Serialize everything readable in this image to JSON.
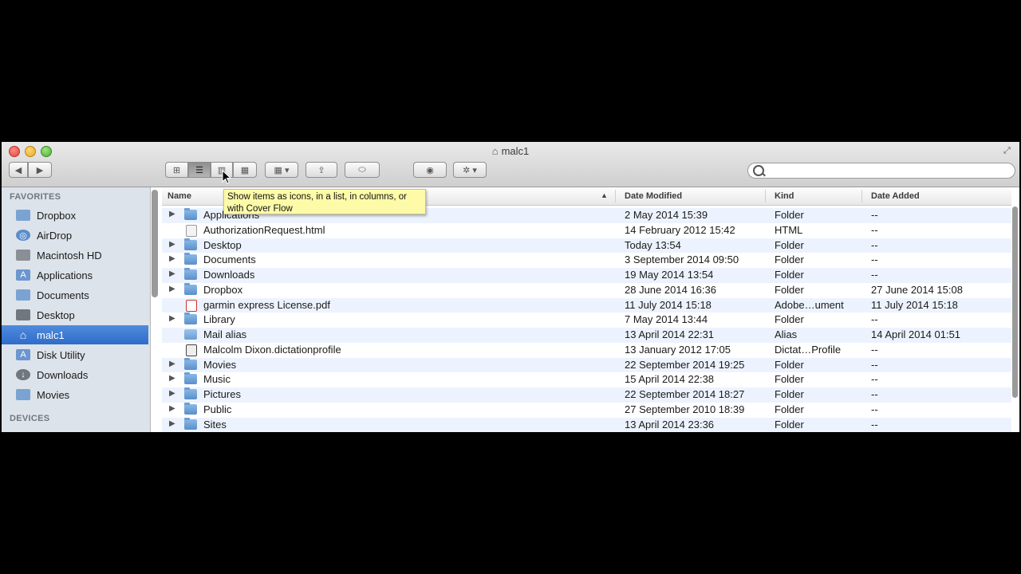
{
  "window": {
    "title": "malc1"
  },
  "search": {
    "placeholder": ""
  },
  "sidebar": {
    "favorites_header": "FAVORITES",
    "devices_header": "DEVICES",
    "items": [
      {
        "label": "Dropbox",
        "icon": "folder-icon"
      },
      {
        "label": "AirDrop",
        "icon": "airdrop-icon"
      },
      {
        "label": "Macintosh HD",
        "icon": "hard-drive-icon"
      },
      {
        "label": "Applications",
        "icon": "applications-icon"
      },
      {
        "label": "Documents",
        "icon": "documents-icon"
      },
      {
        "label": "Desktop",
        "icon": "desktop-icon"
      },
      {
        "label": "malc1",
        "icon": "home-icon",
        "selected": true
      },
      {
        "label": "Disk Utility",
        "icon": "disk-utility-icon"
      },
      {
        "label": "Downloads",
        "icon": "downloads-icon"
      },
      {
        "label": "Movies",
        "icon": "movies-icon"
      }
    ]
  },
  "columns": {
    "name": "Name",
    "date_modified": "Date Modified",
    "kind": "Kind",
    "date_added": "Date Added"
  },
  "tooltip": {
    "text": "Show items as icons, in a list, in columns, or with Cover Flow"
  },
  "rows": [
    {
      "name": "Applications",
      "date": "2 May 2014 15:39",
      "kind": "Folder",
      "added": "--",
      "type": "folder",
      "expandable": true
    },
    {
      "name": "AuthorizationRequest.html",
      "date": "14 February 2012 15:42",
      "kind": "HTML",
      "added": "--",
      "type": "html",
      "expandable": false
    },
    {
      "name": "Desktop",
      "date": "Today 13:54",
      "kind": "Folder",
      "added": "--",
      "type": "folder",
      "expandable": true
    },
    {
      "name": "Documents",
      "date": "3 September 2014 09:50",
      "kind": "Folder",
      "added": "--",
      "type": "folder",
      "expandable": true
    },
    {
      "name": "Downloads",
      "date": "19 May 2014 13:54",
      "kind": "Folder",
      "added": "--",
      "type": "folder",
      "expandable": true
    },
    {
      "name": "Dropbox",
      "date": "28 June 2014 16:36",
      "kind": "Folder",
      "added": "27 June 2014 15:08",
      "type": "folder",
      "expandable": true
    },
    {
      "name": "garmin express License.pdf",
      "date": "11 July 2014 15:18",
      "kind": "Adobe…ument",
      "added": "11 July 2014 15:18",
      "type": "pdf",
      "expandable": false
    },
    {
      "name": "Library",
      "date": "7 May 2014 13:44",
      "kind": "Folder",
      "added": "--",
      "type": "folder",
      "expandable": true
    },
    {
      "name": "Mail alias",
      "date": "13 April 2014 22:31",
      "kind": "Alias",
      "added": "14 April 2014 01:51",
      "type": "alias",
      "expandable": false
    },
    {
      "name": "Malcolm Dixon.dictationprofile",
      "date": "13 January 2012 17:05",
      "kind": "Dictat…Profile",
      "added": "--",
      "type": "profile",
      "expandable": false
    },
    {
      "name": "Movies",
      "date": "22 September 2014 19:25",
      "kind": "Folder",
      "added": "--",
      "type": "folder",
      "expandable": true
    },
    {
      "name": "Music",
      "date": "15 April 2014 22:38",
      "kind": "Folder",
      "added": "--",
      "type": "folder",
      "expandable": true
    },
    {
      "name": "Pictures",
      "date": "22 September 2014 18:27",
      "kind": "Folder",
      "added": "--",
      "type": "folder",
      "expandable": true
    },
    {
      "name": "Public",
      "date": "27 September 2010 18:39",
      "kind": "Folder",
      "added": "--",
      "type": "folder",
      "expandable": true
    },
    {
      "name": "Sites",
      "date": "13 April 2014 23:36",
      "kind": "Folder",
      "added": "--",
      "type": "folder",
      "expandable": true
    }
  ]
}
